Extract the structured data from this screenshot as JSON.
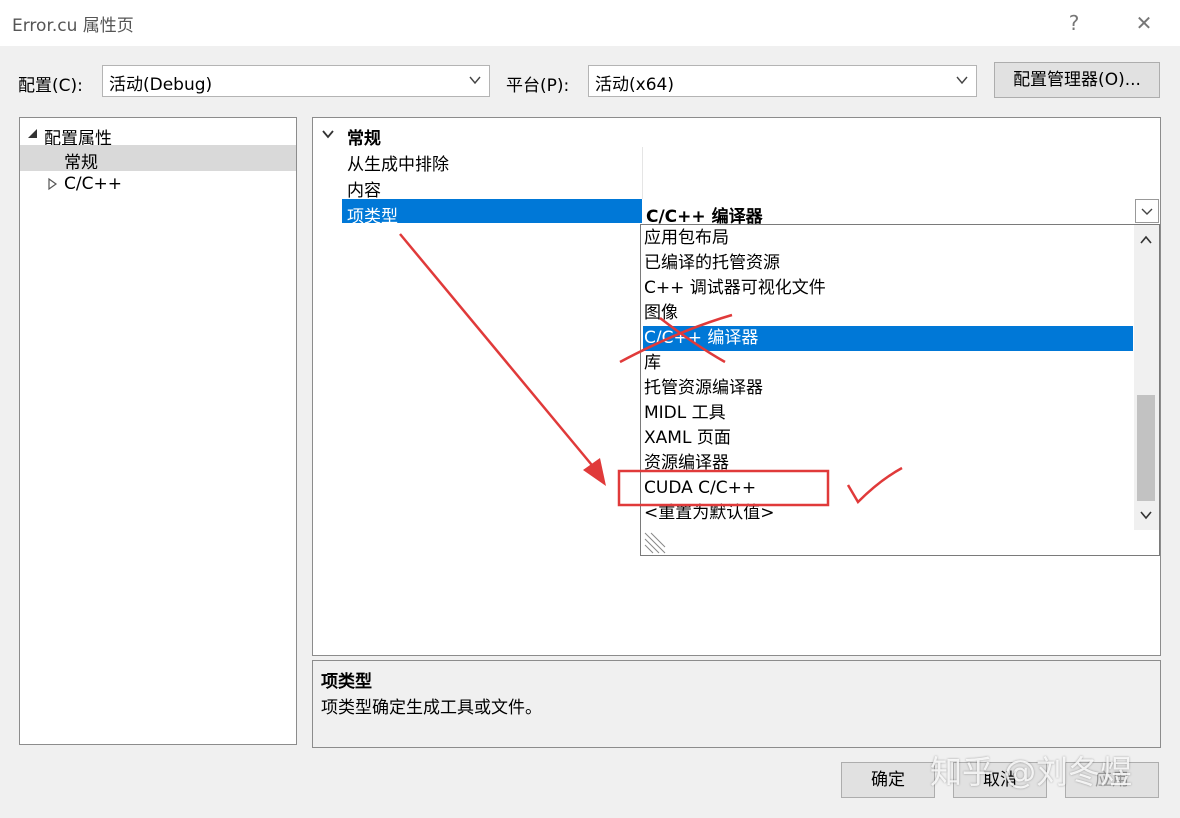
{
  "window": {
    "title": "Error.cu 属性页",
    "help_glyph": "?",
    "close_glyph": "✕"
  },
  "config_bar": {
    "config_label": "配置(C):",
    "config_value": "活动(Debug)",
    "platform_label": "平台(P):",
    "platform_value": "活动(x64)",
    "manager_button": "配置管理器(O)..."
  },
  "tree": {
    "root_label": "配置属性",
    "items": [
      {
        "label": "常规",
        "selected": true
      },
      {
        "label": "C/C++",
        "selected": false
      }
    ]
  },
  "grid": {
    "category": "常规",
    "rows": [
      {
        "name": "从生成中排除",
        "value": ""
      },
      {
        "name": "内容",
        "value": ""
      },
      {
        "name": "项类型",
        "value": "C/C++ 编译器",
        "selected": true
      }
    ]
  },
  "dropdown": {
    "items": [
      "应用包布局",
      "已编译的托管资源",
      "C++ 调试器可视化文件",
      "图像",
      "C/C++ 编译器",
      "库",
      "托管资源编译器",
      "MIDL 工具",
      "XAML 页面",
      "资源编译器",
      "CUDA C/C++",
      "<重置为默认值>"
    ],
    "highlighted_index": 4
  },
  "description": {
    "title": "项类型",
    "text": "项类型确定生成工具或文件。"
  },
  "footer": {
    "ok_button": "确定",
    "cancel_button": "取消",
    "apply_button": "应用"
  },
  "watermark": "知乎 @刘冬煜",
  "colors": {
    "selection": "#0078d7",
    "tree_selection": "#d9d9d9",
    "annotation": "#e03a3a"
  }
}
